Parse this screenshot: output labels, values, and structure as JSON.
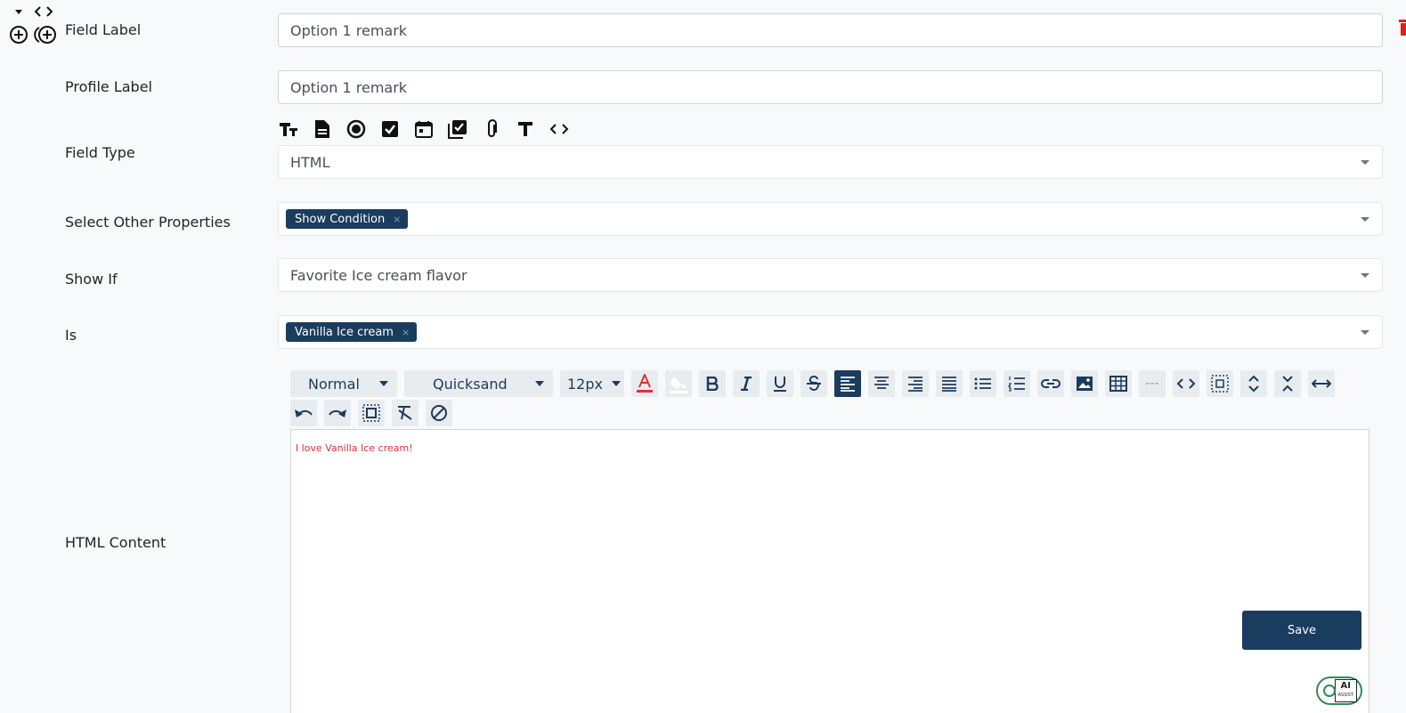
{
  "fields": {
    "field_label": {
      "label": "Field Label",
      "value": "Option 1 remark"
    },
    "profile_label": {
      "label": "Profile Label",
      "value": "Option 1 remark"
    },
    "field_type": {
      "label": "Field Type",
      "value": "HTML"
    },
    "other_properties": {
      "label": "Select Other Properties",
      "chips": [
        "Show Condition"
      ]
    },
    "show_if": {
      "label": "Show If",
      "value": "Favorite Ice cream flavor"
    },
    "is": {
      "label": "Is",
      "chips": [
        "Vanilla Ice cream"
      ]
    },
    "html_content": {
      "label": "HTML Content"
    }
  },
  "field_type_icons": [
    "text-size-icon",
    "document-icon",
    "radio-icon",
    "checkbox-icon",
    "calendar-icon",
    "multi-checkbox-icon",
    "paperclip-icon",
    "text-icon",
    "code-icon"
  ],
  "editor": {
    "style_select": "Normal",
    "font_select": "Quicksand",
    "size_select": "12px",
    "content": "I love Vanilla Ice cream!",
    "hr_label": "---"
  },
  "save_label": "Save",
  "ai_badge": {
    "title": "AI",
    "subtitle": "ASSIST"
  },
  "chip_remove": "×",
  "colors": {
    "primary": "#1a3c5e",
    "text_red": "#e0303a",
    "delete_red": "#e02020"
  }
}
